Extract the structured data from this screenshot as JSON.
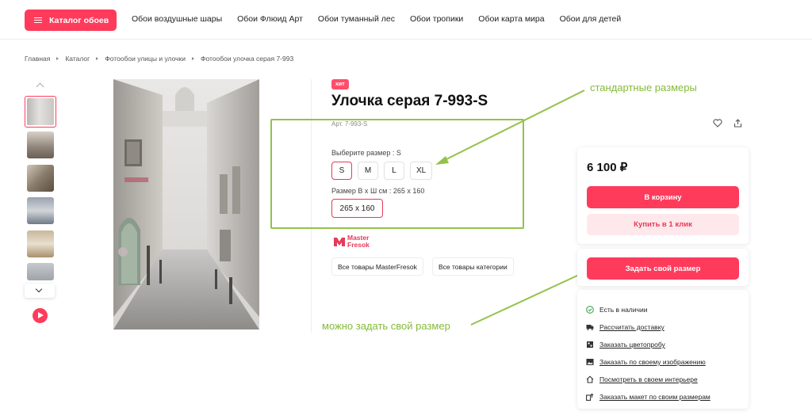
{
  "header": {
    "catalog_button": "Каталог обоев",
    "nav": [
      "Обои воздушные шары",
      "Обои Флюид Арт",
      "Обои туманный лес",
      "Обои тропики",
      "Обои карта мира",
      "Обои для детей"
    ]
  },
  "breadcrumb": [
    "Главная",
    "Каталог",
    "Фотообои улицы и улочки",
    "Фотообои улочка серая 7-993"
  ],
  "product": {
    "badge": "хит",
    "title": "Улочка серая 7-993-S",
    "article": "Арт. 7-993-S",
    "size_label": "Выберите размер : S",
    "sizes": [
      "S",
      "M",
      "L",
      "XL"
    ],
    "selected_size": "S",
    "dim_label": "Размер В х Ш см : 265 х 160",
    "dim_value": "265 х 160",
    "brand_line1": "Master",
    "brand_line2": "Fresok",
    "tags": [
      "Все товары MasterFresok",
      "Все товары категории"
    ]
  },
  "annotations": {
    "standard_sizes": "стандартные размеры",
    "custom_size": "можно задать свой размер"
  },
  "purchase": {
    "price": "6 100 ₽",
    "cart_button": "В корзину",
    "oneclick_button": "Купить в 1 клик",
    "custom_size_button": "Задать свой размер"
  },
  "features": [
    {
      "icon": "check-circle-icon",
      "text": "Есть в наличии",
      "link": false
    },
    {
      "icon": "truck-icon",
      "text": "Рассчитать доставку",
      "link": true
    },
    {
      "icon": "color-sample-icon",
      "text": "Заказать цветопробу",
      "link": true
    },
    {
      "icon": "image-icon",
      "text": "Заказать по своему изображению",
      "link": true
    },
    {
      "icon": "home-icon",
      "text": "Посмотреть в своем интерьере",
      "link": true
    },
    {
      "icon": "layout-icon",
      "text": "Заказать макет по своим размерам",
      "link": true
    }
  ],
  "colors": {
    "accent": "#ff3b5c",
    "accent_light": "#ffe8ec",
    "annotation_green": "#93c24a"
  }
}
